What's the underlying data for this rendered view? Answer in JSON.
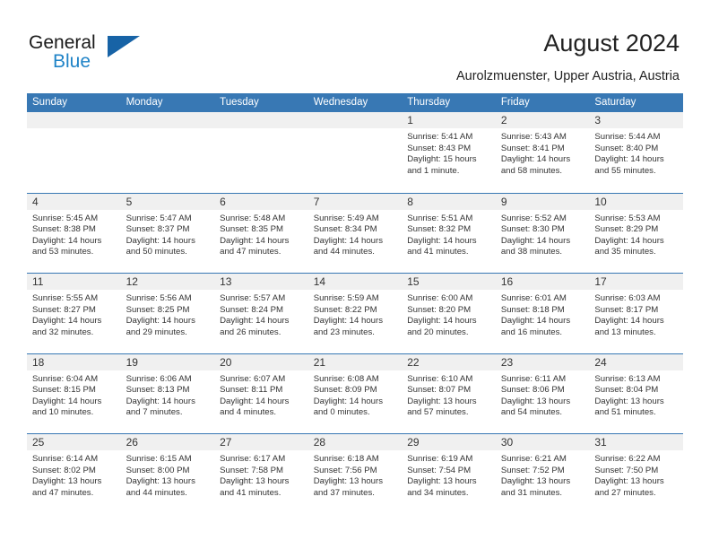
{
  "logo": {
    "word1": "General",
    "word2": "Blue",
    "triangle_color": "#1763a6",
    "blue_color": "#1f83c7"
  },
  "header": {
    "title": "August 2024",
    "location": "Aurolzmuenster, Upper Austria, Austria"
  },
  "colors": {
    "header_blue": "#3878b4",
    "day_strip_gray": "#f0f0f0",
    "text": "#333333"
  },
  "calendar": {
    "weekdays": [
      "Sunday",
      "Monday",
      "Tuesday",
      "Wednesday",
      "Thursday",
      "Friday",
      "Saturday"
    ],
    "labels": {
      "sunrise": "Sunrise:",
      "sunset": "Sunset:",
      "daylight": "Daylight:"
    },
    "weeks": [
      [
        {
          "day": "",
          "sunrise": "",
          "sunset": "",
          "daylight": "",
          "empty": true
        },
        {
          "day": "",
          "sunrise": "",
          "sunset": "",
          "daylight": "",
          "empty": true
        },
        {
          "day": "",
          "sunrise": "",
          "sunset": "",
          "daylight": "",
          "empty": true
        },
        {
          "day": "",
          "sunrise": "",
          "sunset": "",
          "daylight": "",
          "empty": true
        },
        {
          "day": "1",
          "sunrise": "Sunrise: 5:41 AM",
          "sunset": "Sunset: 8:43 PM",
          "daylight": "Daylight: 15 hours and 1 minute."
        },
        {
          "day": "2",
          "sunrise": "Sunrise: 5:43 AM",
          "sunset": "Sunset: 8:41 PM",
          "daylight": "Daylight: 14 hours and 58 minutes."
        },
        {
          "day": "3",
          "sunrise": "Sunrise: 5:44 AM",
          "sunset": "Sunset: 8:40 PM",
          "daylight": "Daylight: 14 hours and 55 minutes."
        }
      ],
      [
        {
          "day": "4",
          "sunrise": "Sunrise: 5:45 AM",
          "sunset": "Sunset: 8:38 PM",
          "daylight": "Daylight: 14 hours and 53 minutes."
        },
        {
          "day": "5",
          "sunrise": "Sunrise: 5:47 AM",
          "sunset": "Sunset: 8:37 PM",
          "daylight": "Daylight: 14 hours and 50 minutes."
        },
        {
          "day": "6",
          "sunrise": "Sunrise: 5:48 AM",
          "sunset": "Sunset: 8:35 PM",
          "daylight": "Daylight: 14 hours and 47 minutes."
        },
        {
          "day": "7",
          "sunrise": "Sunrise: 5:49 AM",
          "sunset": "Sunset: 8:34 PM",
          "daylight": "Daylight: 14 hours and 44 minutes."
        },
        {
          "day": "8",
          "sunrise": "Sunrise: 5:51 AM",
          "sunset": "Sunset: 8:32 PM",
          "daylight": "Daylight: 14 hours and 41 minutes."
        },
        {
          "day": "9",
          "sunrise": "Sunrise: 5:52 AM",
          "sunset": "Sunset: 8:30 PM",
          "daylight": "Daylight: 14 hours and 38 minutes."
        },
        {
          "day": "10",
          "sunrise": "Sunrise: 5:53 AM",
          "sunset": "Sunset: 8:29 PM",
          "daylight": "Daylight: 14 hours and 35 minutes."
        }
      ],
      [
        {
          "day": "11",
          "sunrise": "Sunrise: 5:55 AM",
          "sunset": "Sunset: 8:27 PM",
          "daylight": "Daylight: 14 hours and 32 minutes."
        },
        {
          "day": "12",
          "sunrise": "Sunrise: 5:56 AM",
          "sunset": "Sunset: 8:25 PM",
          "daylight": "Daylight: 14 hours and 29 minutes."
        },
        {
          "day": "13",
          "sunrise": "Sunrise: 5:57 AM",
          "sunset": "Sunset: 8:24 PM",
          "daylight": "Daylight: 14 hours and 26 minutes."
        },
        {
          "day": "14",
          "sunrise": "Sunrise: 5:59 AM",
          "sunset": "Sunset: 8:22 PM",
          "daylight": "Daylight: 14 hours and 23 minutes."
        },
        {
          "day": "15",
          "sunrise": "Sunrise: 6:00 AM",
          "sunset": "Sunset: 8:20 PM",
          "daylight": "Daylight: 14 hours and 20 minutes."
        },
        {
          "day": "16",
          "sunrise": "Sunrise: 6:01 AM",
          "sunset": "Sunset: 8:18 PM",
          "daylight": "Daylight: 14 hours and 16 minutes."
        },
        {
          "day": "17",
          "sunrise": "Sunrise: 6:03 AM",
          "sunset": "Sunset: 8:17 PM",
          "daylight": "Daylight: 14 hours and 13 minutes."
        }
      ],
      [
        {
          "day": "18",
          "sunrise": "Sunrise: 6:04 AM",
          "sunset": "Sunset: 8:15 PM",
          "daylight": "Daylight: 14 hours and 10 minutes."
        },
        {
          "day": "19",
          "sunrise": "Sunrise: 6:06 AM",
          "sunset": "Sunset: 8:13 PM",
          "daylight": "Daylight: 14 hours and 7 minutes."
        },
        {
          "day": "20",
          "sunrise": "Sunrise: 6:07 AM",
          "sunset": "Sunset: 8:11 PM",
          "daylight": "Daylight: 14 hours and 4 minutes."
        },
        {
          "day": "21",
          "sunrise": "Sunrise: 6:08 AM",
          "sunset": "Sunset: 8:09 PM",
          "daylight": "Daylight: 14 hours and 0 minutes."
        },
        {
          "day": "22",
          "sunrise": "Sunrise: 6:10 AM",
          "sunset": "Sunset: 8:07 PM",
          "daylight": "Daylight: 13 hours and 57 minutes."
        },
        {
          "day": "23",
          "sunrise": "Sunrise: 6:11 AM",
          "sunset": "Sunset: 8:06 PM",
          "daylight": "Daylight: 13 hours and 54 minutes."
        },
        {
          "day": "24",
          "sunrise": "Sunrise: 6:13 AM",
          "sunset": "Sunset: 8:04 PM",
          "daylight": "Daylight: 13 hours and 51 minutes."
        }
      ],
      [
        {
          "day": "25",
          "sunrise": "Sunrise: 6:14 AM",
          "sunset": "Sunset: 8:02 PM",
          "daylight": "Daylight: 13 hours and 47 minutes."
        },
        {
          "day": "26",
          "sunrise": "Sunrise: 6:15 AM",
          "sunset": "Sunset: 8:00 PM",
          "daylight": "Daylight: 13 hours and 44 minutes."
        },
        {
          "day": "27",
          "sunrise": "Sunrise: 6:17 AM",
          "sunset": "Sunset: 7:58 PM",
          "daylight": "Daylight: 13 hours and 41 minutes."
        },
        {
          "day": "28",
          "sunrise": "Sunrise: 6:18 AM",
          "sunset": "Sunset: 7:56 PM",
          "daylight": "Daylight: 13 hours and 37 minutes."
        },
        {
          "day": "29",
          "sunrise": "Sunrise: 6:19 AM",
          "sunset": "Sunset: 7:54 PM",
          "daylight": "Daylight: 13 hours and 34 minutes."
        },
        {
          "day": "30",
          "sunrise": "Sunrise: 6:21 AM",
          "sunset": "Sunset: 7:52 PM",
          "daylight": "Daylight: 13 hours and 31 minutes."
        },
        {
          "day": "31",
          "sunrise": "Sunrise: 6:22 AM",
          "sunset": "Sunset: 7:50 PM",
          "daylight": "Daylight: 13 hours and 27 minutes."
        }
      ]
    ]
  }
}
